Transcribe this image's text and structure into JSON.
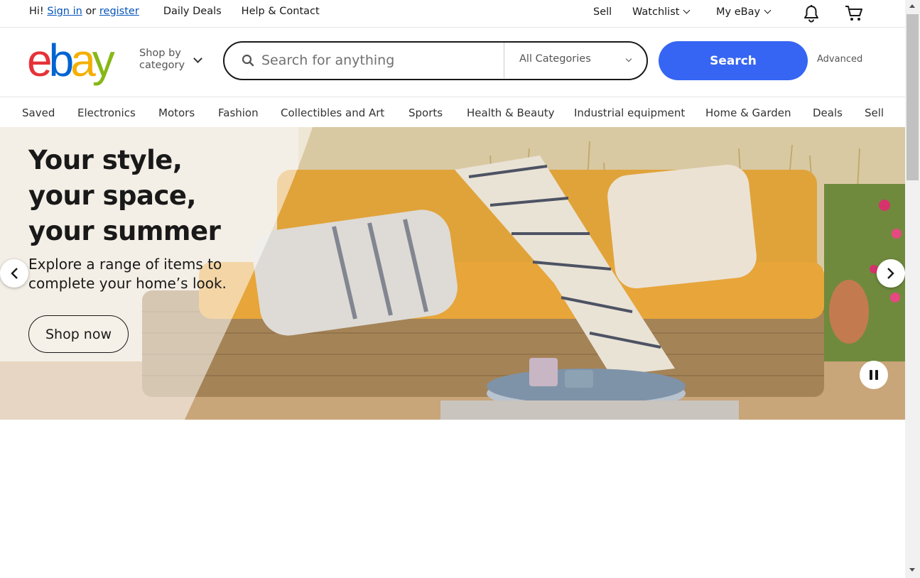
{
  "topbar": {
    "greeting": "Hi!",
    "sign_in": "Sign in",
    "or": "or",
    "register": "register",
    "daily_deals": "Daily Deals",
    "help_contact": "Help & Contact",
    "sell": "Sell",
    "watchlist": "Watchlist",
    "my_ebay": "My eBay"
  },
  "header": {
    "logo_letters": [
      "e",
      "b",
      "a",
      "y"
    ],
    "logo_colors": [
      "#e53238",
      "#0064d2",
      "#f5af02",
      "#86b817"
    ],
    "shop_by_line1": "Shop by",
    "shop_by_line2": "category",
    "search_placeholder": "Search for anything",
    "category_select": "All Categories",
    "search_button": "Search",
    "advanced": "Advanced"
  },
  "nav": {
    "items": [
      "Saved",
      "Electronics",
      "Motors",
      "Fashion",
      "Collectibles and Art",
      "Sports",
      "Health & Beauty",
      "Industrial equipment",
      "Home & Garden",
      "Deals",
      "Sell"
    ]
  },
  "hero": {
    "title": "Your style, your space, your summer",
    "subtitle": "Explore a range of items to complete your home’s look.",
    "cta": "Shop now"
  },
  "colors": {
    "accent": "#3665f3",
    "link": "#0654ba"
  }
}
